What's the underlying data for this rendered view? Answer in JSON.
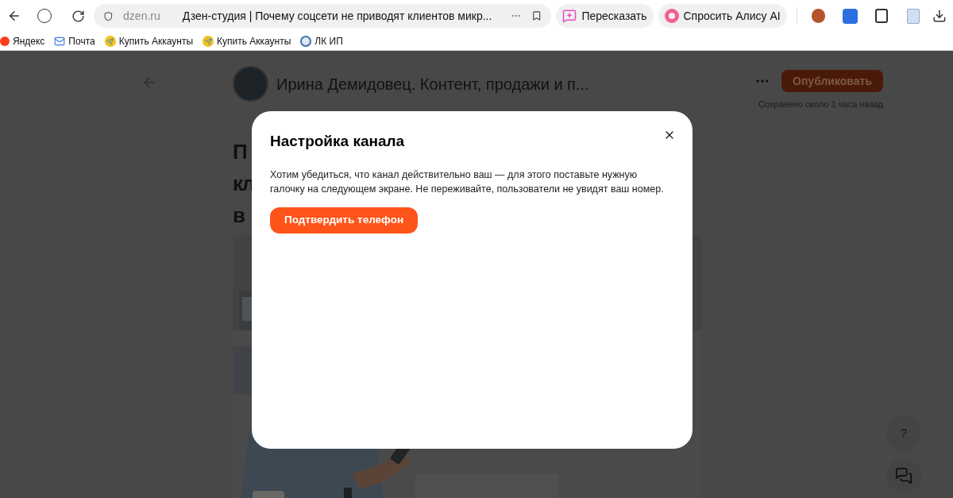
{
  "browser": {
    "url_domain": "dzen.ru",
    "page_title": "Дзен-студия | Почему соцсети не приводят клиентов микр...",
    "actions": [
      {
        "label": "Пересказать",
        "kind": "retell"
      },
      {
        "label": "Спросить Алису AI",
        "kind": "alice"
      }
    ],
    "bookmarks": [
      {
        "label": "Яндекс",
        "kind": "yandex"
      },
      {
        "label": "Почта",
        "kind": "mail"
      },
      {
        "label": "Купить Аккаунты",
        "kind": "telegram"
      },
      {
        "label": "Купить Аккаунты",
        "kind": "telegram"
      },
      {
        "label": "ЛК ИП",
        "kind": "tax"
      }
    ]
  },
  "editor": {
    "channel_name": "Ирина Демидовец. Контент, продажи и п...",
    "publish_button": "Опубликовать",
    "saved_status": "Сохранено около 1 часа назад",
    "heading_fragments": [
      "П",
      "кл",
      "в"
    ]
  },
  "modal": {
    "title": "Настройка канала",
    "text": "Хотим убедиться, что канал действительно ваш — для этого поставьте нужную галочку на следующем экране. Не переживайте, пользователи не увидят ваш номер.",
    "button": "Подтвердить телефон"
  },
  "help": {
    "question_label": "?"
  }
}
